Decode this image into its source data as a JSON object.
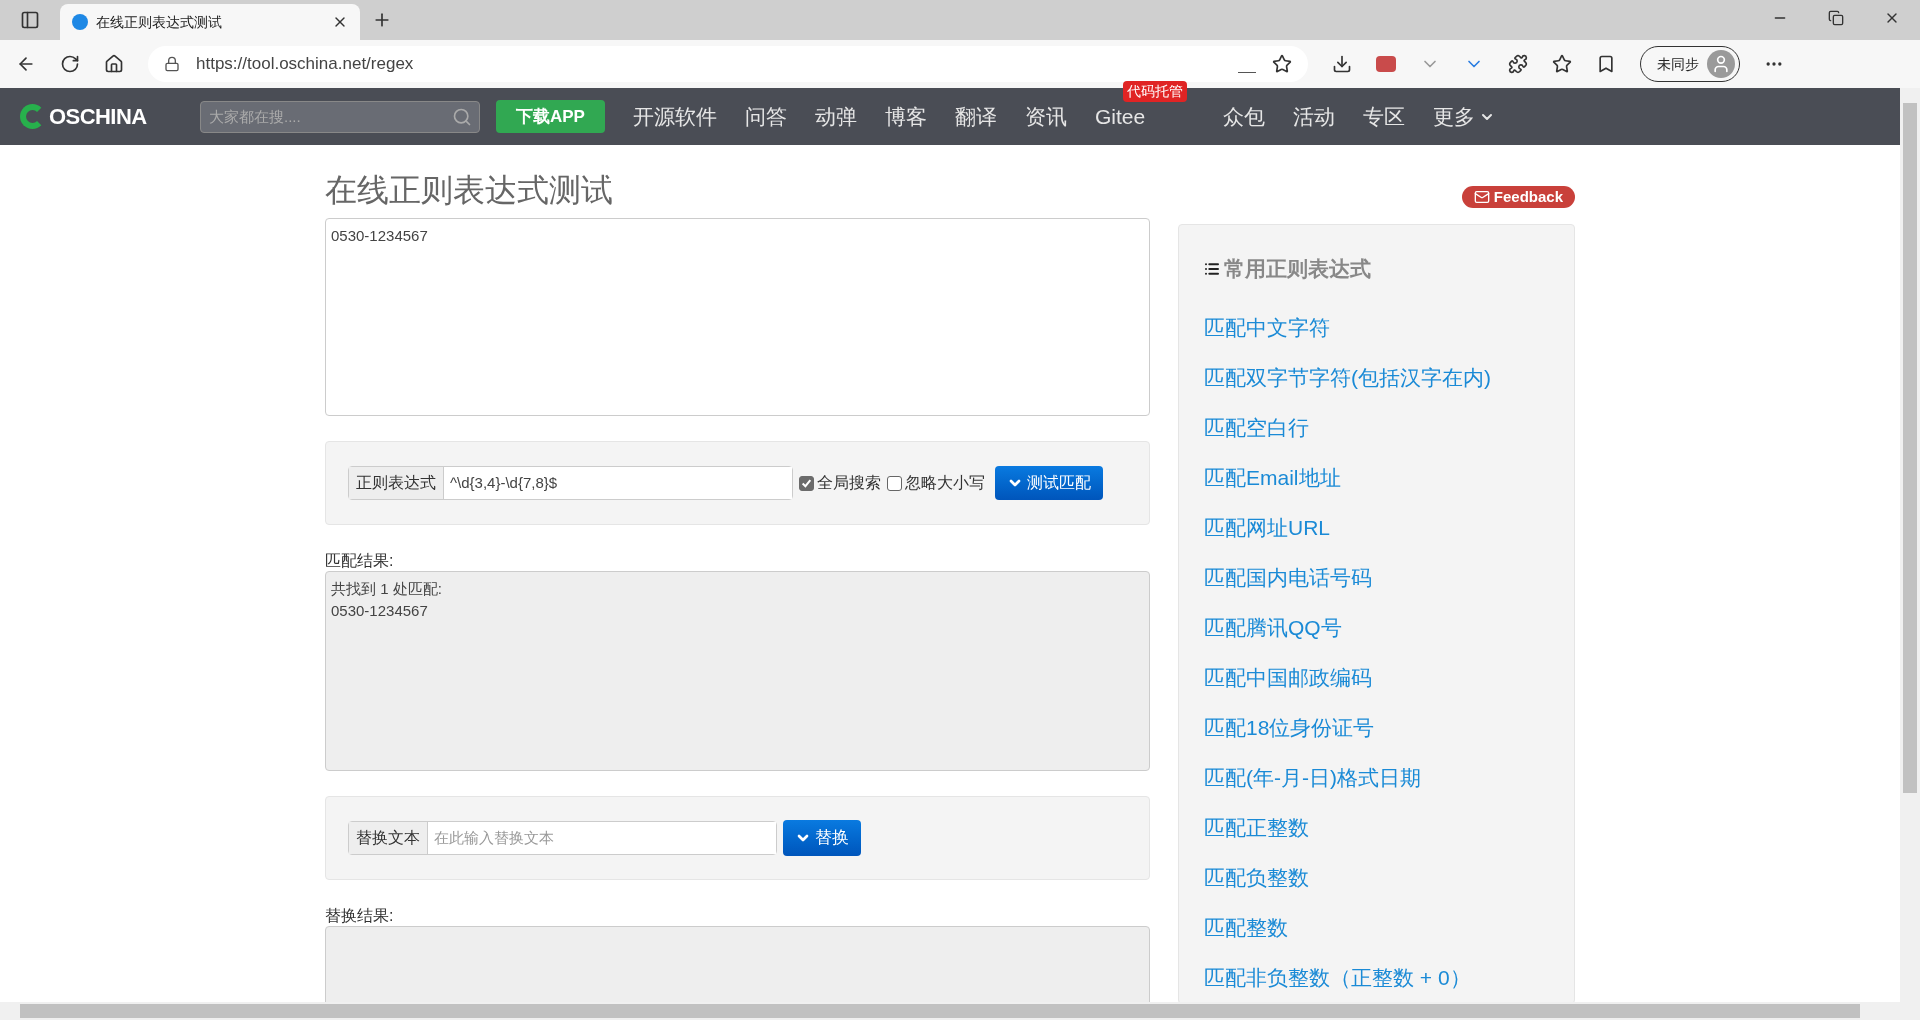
{
  "browser": {
    "tab_title": "在线正则表达式测试",
    "url": "https://tool.oschina.net/regex",
    "profile": "未同步"
  },
  "nav": {
    "logo": "OSCHINA",
    "search_placeholder": "大家都在搜....",
    "download": "下载APP",
    "items": [
      {
        "label": "开源软件"
      },
      {
        "label": "问答"
      },
      {
        "label": "动弹"
      },
      {
        "label": "博客"
      },
      {
        "label": "翻译"
      },
      {
        "label": "资讯"
      },
      {
        "label": "Gitee",
        "badge": "代码托管"
      },
      {
        "label": "众包"
      },
      {
        "label": "活动"
      },
      {
        "label": "专区"
      },
      {
        "label": "更多",
        "dropdown": true
      }
    ]
  },
  "page": {
    "title": "在线正则表达式测试",
    "feedback": "Feedback",
    "input_text": "0530-1234567",
    "regex": {
      "label": "正则表达式",
      "value": "^\\d{3,4}-\\d{7,8}$",
      "options": [
        {
          "label": "全局搜索",
          "checked": true
        },
        {
          "label": "忽略大小写",
          "checked": false
        }
      ],
      "button": "测试匹配"
    },
    "match_label": "匹配结果:",
    "match_result": [
      "共找到 1 处匹配:",
      "0530-1234567"
    ],
    "replace": {
      "label": "替换文本",
      "placeholder": "在此输入替换文本",
      "button": "替换"
    },
    "replace_label": "替换结果:"
  },
  "sidebar": {
    "title": "常用正则表达式",
    "items": [
      "匹配中文字符",
      "匹配双字节字符(包括汉字在内)",
      "匹配空白行",
      "匹配Email地址",
      "匹配网址URL",
      "匹配国内电话号码",
      "匹配腾讯QQ号",
      "匹配中国邮政编码",
      "匹配18位身份证号",
      "匹配(年-月-日)格式日期",
      "匹配正整数",
      "匹配负整数",
      "匹配整数",
      "匹配非负整数（正整数 + 0）"
    ]
  }
}
